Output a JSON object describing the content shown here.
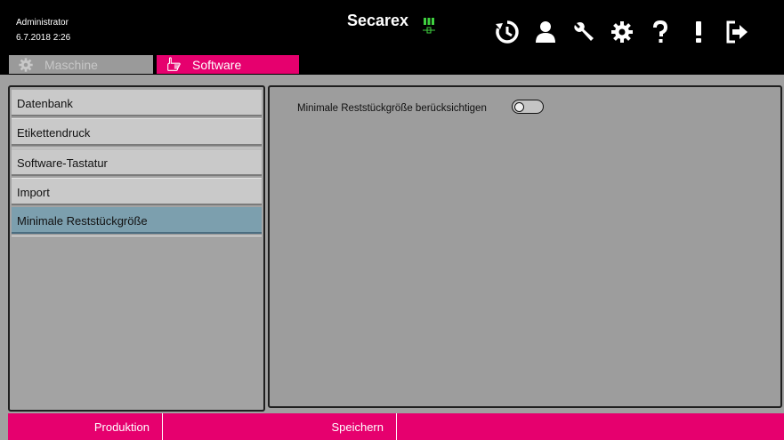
{
  "header": {
    "user_name": "Administrator",
    "timestamp": "6.7.2018 2:26",
    "brand": "Secarex",
    "icons": [
      "history-icon",
      "user-icon",
      "wrench-icon",
      "gear-icon",
      "help-icon",
      "alert-icon",
      "logout-icon"
    ]
  },
  "tabs": [
    {
      "label": "Maschine",
      "icon": "gear-icon",
      "active": false
    },
    {
      "label": "Software",
      "icon": "hand-pointer-icon",
      "active": true
    }
  ],
  "sidebar": {
    "items": [
      {
        "label": "Datenbank",
        "selected": false
      },
      {
        "label": "Etikettendruck",
        "selected": false
      },
      {
        "label": "Software-Tastatur",
        "selected": false
      },
      {
        "label": "Import",
        "selected": false
      },
      {
        "label": "Minimale Reststückgröße",
        "selected": true
      }
    ]
  },
  "content": {
    "option_label": "Minimale Reststückgröße berücksichtigen",
    "option_enabled": false
  },
  "footer": {
    "production_label": "Produktion",
    "save_label": "Speichern"
  },
  "colors": {
    "accent": "#e6006e",
    "selected_item": "#7c9fae",
    "brand_icon": "#3fd13f"
  }
}
